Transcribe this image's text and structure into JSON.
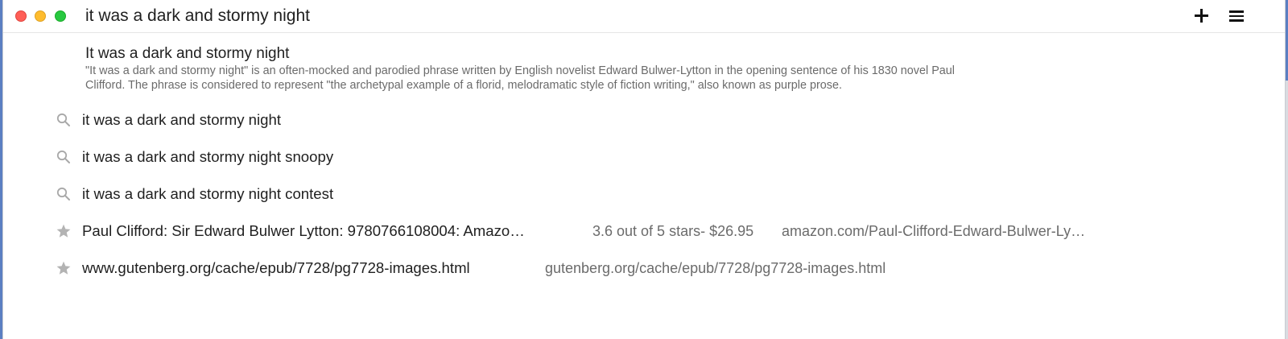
{
  "search": {
    "value": "it was a dark and stormy night"
  },
  "knowledge_panel": {
    "title": "It was a dark and stormy night",
    "description_line1": "\"It was a dark and stormy night\" is an often-mocked and parodied phrase written by English novelist Edward Bulwer-Lytton in the opening sentence of his 1830 novel Paul",
    "description_line2": "Clifford. The phrase is considered to represent \"the archetypal example of a florid, melodramatic style of fiction writing,\" also known as purple prose."
  },
  "suggestions": [
    {
      "icon": "search-icon",
      "text": "it was a dark and stormy night"
    },
    {
      "icon": "search-icon",
      "text": "it was a dark and stormy night snoopy"
    },
    {
      "icon": "search-icon",
      "text": "it was a dark and stormy night contest"
    }
  ],
  "bookmarks": [
    {
      "icon": "star-icon",
      "title": "Paul Clifford: Sir Edward Bulwer Lytton: 9780766108004: Amazo…",
      "rating": "3.6 out of 5 stars- $26.95",
      "url": "amazon.com/Paul-Clifford-Edward-Bulwer-Ly…"
    },
    {
      "icon": "star-icon",
      "title": "www.gutenberg.org/cache/epub/7728/pg7728-images.html",
      "url": "gutenberg.org/cache/epub/7728/pg7728-images.html"
    }
  ],
  "colors": {
    "close": "#ff5f57",
    "minimize": "#febc2e",
    "zoom": "#28c840",
    "accent": "#5b7fc2"
  }
}
